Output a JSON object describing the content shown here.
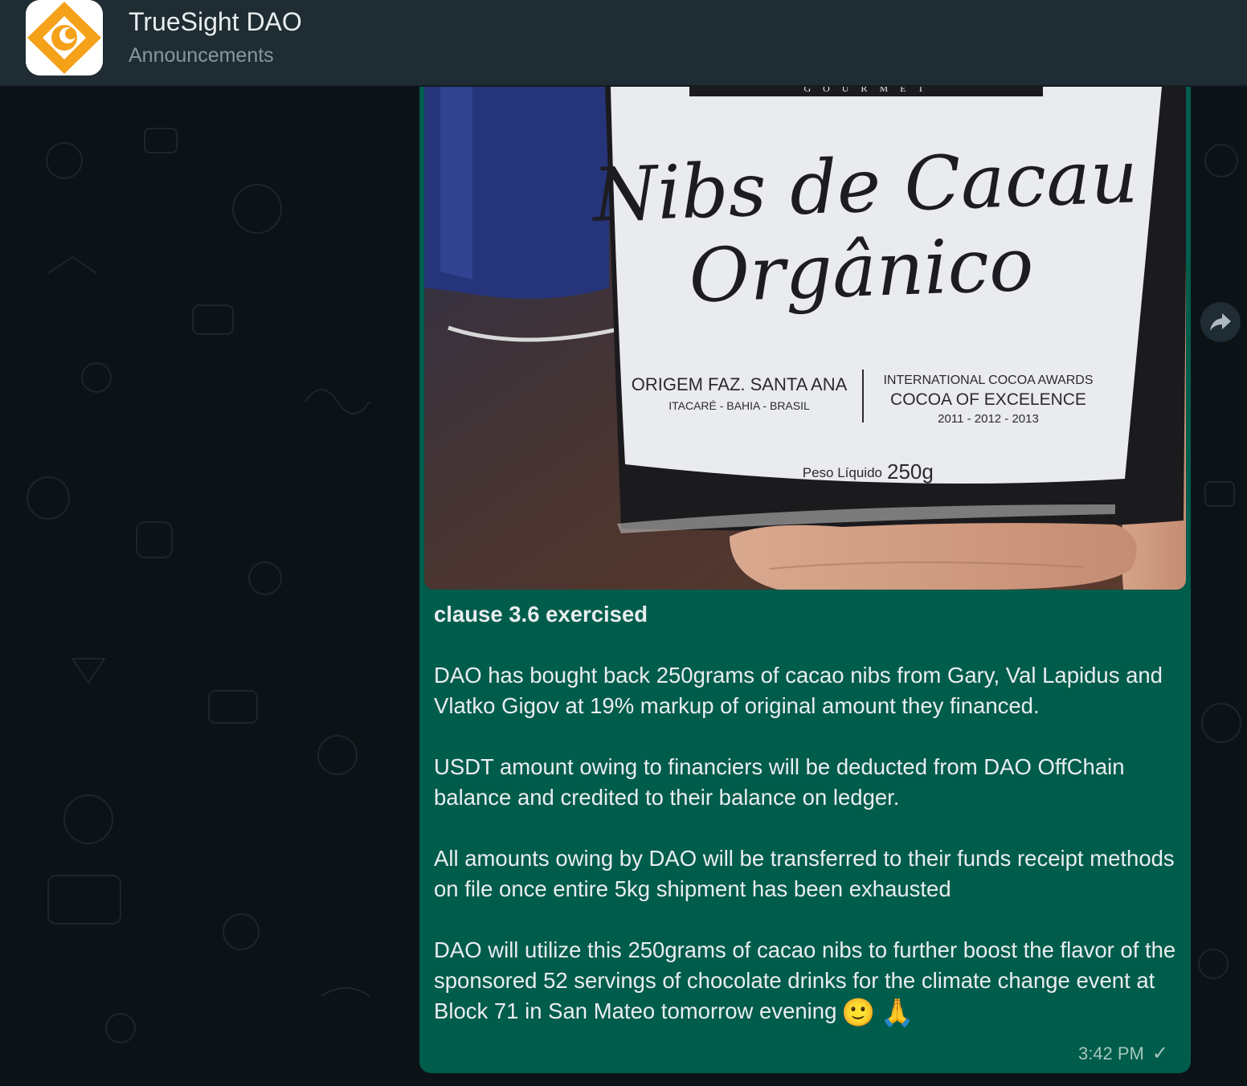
{
  "header": {
    "title": "TrueSight DAO",
    "subtitle": "Announcements",
    "avatar_icon": "truesight-logo"
  },
  "message": {
    "image": {
      "top_label": "G O U R M E T",
      "title_line1": "Nibs de Cacau",
      "title_line2": "Orgânico",
      "origin": "ORIGEM FAZ. SANTA ANA",
      "location": "ITACARÉ - BAHIA - BRASIL",
      "award_line1": "INTERNATIONAL COCOA AWARDS",
      "award_line2": "COCOA OF EXCELENCE",
      "award_years": "2011 - 2012 - 2013",
      "weight_label": "Peso Líquido",
      "weight_value": "250g"
    },
    "caption_title": "clause 3.6 exercised",
    "paragraphs": [
      "DAO has bought back 250grams of cacao nibs from Gary, Val Lapidus and Vlatko Gigov at 19% markup of original amount they financed.",
      "USDT amount owing to financiers will be deducted from DAO OffChain balance and credited to their balance on ledger.",
      "All amounts owing by DAO will be transferred to their funds receipt methods on file once entire 5kg shipment has been exhausted",
      "DAO will utilize this 250grams of cacao nibs to further boost the flavor of the sponsored 52 servings of chocolate drinks for the climate change event at Block 71 in San Mateo tomorrow evening"
    ],
    "emojis": [
      "🙂",
      "🙏"
    ],
    "time": "3:42 PM",
    "status_icon": "check-icon"
  },
  "colors": {
    "header_bg": "#1f2c33",
    "bubble_bg": "#005c4b",
    "chat_bg": "#0c1317",
    "logo_orange": "#f5a11a"
  }
}
